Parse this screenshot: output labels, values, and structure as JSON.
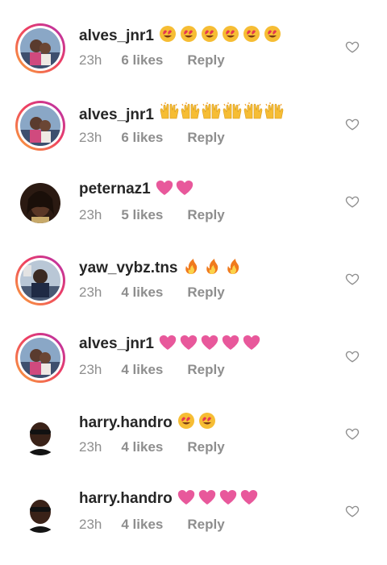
{
  "comments": [
    {
      "username": "alves_jnr1",
      "time": "23h",
      "likes": "6 likes",
      "reply": "Reply",
      "emoji": "smiling-hearts",
      "emoji_count": 6,
      "avatar": "alves",
      "ring": true
    },
    {
      "username": "alves_jnr1",
      "time": "23h",
      "likes": "6 likes",
      "reply": "Reply",
      "emoji": "raised-hands",
      "emoji_count": 6,
      "avatar": "alves",
      "ring": true
    },
    {
      "username": "peternaz1",
      "time": "23h",
      "likes": "5 likes",
      "reply": "Reply",
      "emoji": "pink-heart",
      "emoji_count": 2,
      "avatar": "peter",
      "ring": false
    },
    {
      "username": "yaw_vybz.tns",
      "time": "23h",
      "likes": "4 likes",
      "reply": "Reply",
      "emoji": "fire",
      "emoji_count": 3,
      "avatar": "yaw",
      "ring": true
    },
    {
      "username": "alves_jnr1",
      "time": "23h",
      "likes": "4 likes",
      "reply": "Reply",
      "emoji": "pink-heart",
      "emoji_count": 5,
      "avatar": "alves",
      "ring": true
    },
    {
      "username": "harry.handro",
      "time": "23h",
      "likes": "4 likes",
      "reply": "Reply",
      "emoji": "smiling-hearts",
      "emoji_count": 2,
      "avatar": "harry",
      "ring": false
    },
    {
      "username": "harry.handro",
      "time": "23h",
      "likes": "4 likes",
      "reply": "Reply",
      "emoji": "pink-heart",
      "emoji_count": 4,
      "avatar": "harry",
      "ring": false
    }
  ],
  "colors": {
    "text": "#262626",
    "meta": "#8e8e8e",
    "heart_emoji": "#e8589b",
    "ring_start": "#f9a63a",
    "ring_end": "#b02fb5"
  }
}
